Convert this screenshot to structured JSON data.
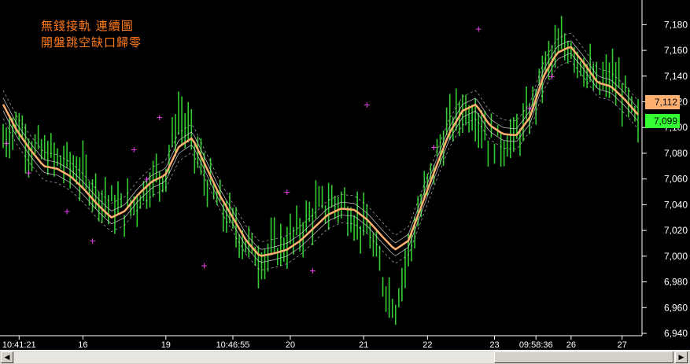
{
  "header": {
    "title_line1": "無錢接軌 連續圖",
    "title_line2": "開盤跳空缺口歸零"
  },
  "price_badges": {
    "last": "7,112",
    "prev": "7,099",
    "last_color": "#ffb070",
    "prev_color": "#33ff33"
  },
  "scrollbar": {
    "left_icon": "arrow-left-icon",
    "right_icon": "arrow-right-icon"
  },
  "chart_data": {
    "type": "bar",
    "style": "ohlc-bars-with-moving-average-envelope",
    "ylim": [
      6940,
      7190
    ],
    "y_ticks": [
      "7,180",
      "7,160",
      "7,140",
      "7,120",
      "7,100",
      "7,080",
      "7,060",
      "7,040",
      "7,020",
      "7,000",
      "6,980",
      "6,960",
      "6,940"
    ],
    "x_tick_labels": [
      {
        "label": "10:41:21",
        "x_index": 5
      },
      {
        "label": "16",
        "x_index": 25
      },
      {
        "label": "19",
        "x_index": 51
      },
      {
        "label": "10:46:55",
        "x_index": 72
      },
      {
        "label": "20",
        "x_index": 90
      },
      {
        "label": "21",
        "x_index": 113
      },
      {
        "label": "22",
        "x_index": 133
      },
      {
        "label": "23",
        "x_index": 154
      },
      {
        "label": "09:58:36",
        "x_index": 167
      },
      {
        "label": "26",
        "x_index": 178
      },
      {
        "label": "27",
        "x_index": 194
      }
    ],
    "grid": false,
    "colors": {
      "bars": "#33cc33",
      "moving_average": "#ffb070",
      "envelope": "#cccccc",
      "markers": "#ff44ff",
      "axis": "#ffffff"
    },
    "moving_average": [
      7118,
      7098,
      7083,
      7070,
      7068,
      7062,
      7052,
      7040,
      7030,
      7035,
      7048,
      7058,
      7063,
      7085,
      7092,
      7070,
      7048,
      7030,
      7012,
      7000,
      7002,
      7005,
      7012,
      7022,
      7032,
      7037,
      7036,
      7028,
      7016,
      7005,
      7012,
      7040,
      7068,
      7095,
      7113,
      7118,
      7102,
      7095,
      7094,
      7108,
      7140,
      7158,
      7163,
      7150,
      7135,
      7132,
      7122,
      7110
    ],
    "price_path": [
      7090,
      7105,
      7085,
      7080,
      7075,
      7070,
      7062,
      7050,
      7040,
      7035,
      7045,
      7060,
      7065,
      7110,
      7090,
      7060,
      7040,
      7025,
      7010,
      6998,
      7005,
      7010,
      7020,
      7035,
      7040,
      7042,
      7030,
      7020,
      6985,
      6960,
      7005,
      7040,
      7075,
      7100,
      7115,
      7112,
      7090,
      7088,
      7092,
      7110,
      7145,
      7160,
      7165,
      7148,
      7130,
      7140,
      7125,
      7099
    ],
    "markers": [
      {
        "x_index": 1,
        "value": 7088
      },
      {
        "x_index": 8,
        "value": 7065
      },
      {
        "x_index": 20,
        "value": 7035
      },
      {
        "x_index": 28,
        "value": 7012
      },
      {
        "x_index": 41,
        "value": 7083
      },
      {
        "x_index": 45,
        "value": 7060
      },
      {
        "x_index": 49,
        "value": 7108
      },
      {
        "x_index": 63,
        "value": 6993
      },
      {
        "x_index": 89,
        "value": 7050
      },
      {
        "x_index": 97,
        "value": 6989
      },
      {
        "x_index": 114,
        "value": 7118
      },
      {
        "x_index": 135,
        "value": 7085
      },
      {
        "x_index": 149,
        "value": 7177
      },
      {
        "x_index": 165,
        "value": 7115
      },
      {
        "x_index": 172,
        "value": 7140
      }
    ]
  }
}
